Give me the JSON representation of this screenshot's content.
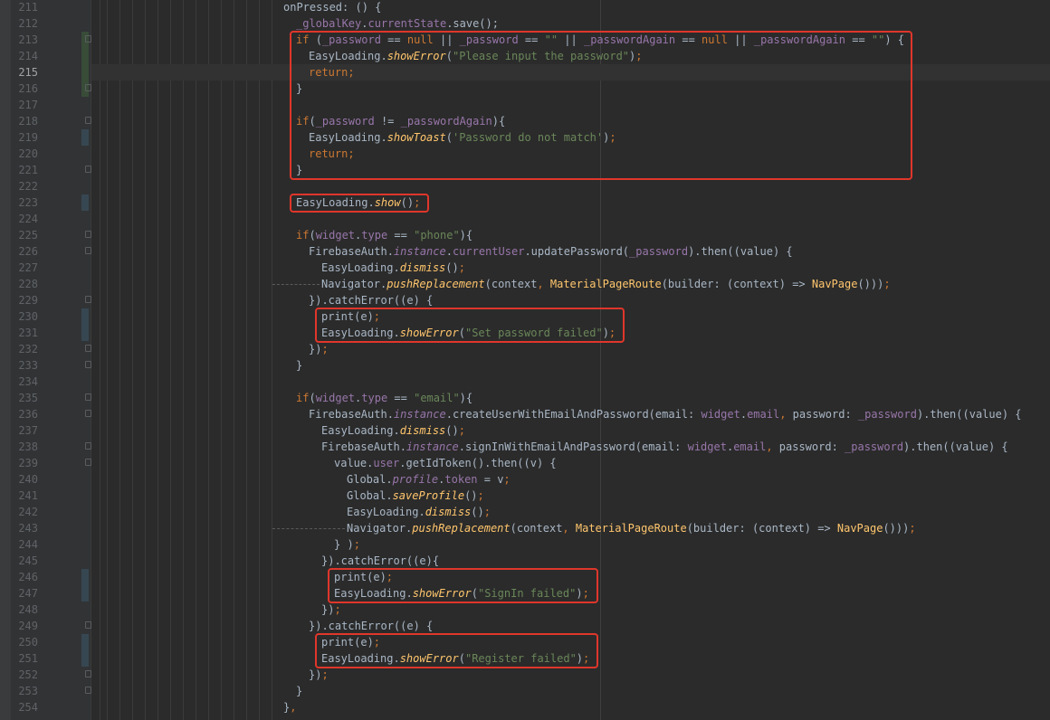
{
  "editor": {
    "current_line": 215,
    "lines": [
      {
        "n": 211,
        "indent": 0,
        "change": "",
        "fold": false,
        "t": [
          {
            "c": "",
            "v": "onPressed: () {"
          }
        ]
      },
      {
        "n": 212,
        "indent": 1,
        "change": "",
        "fold": false,
        "t": [
          {
            "c": "p",
            "v": "_globalKey"
          },
          {
            "c": "",
            "v": "."
          },
          {
            "c": "p",
            "v": "currentState"
          },
          {
            "c": "",
            "v": ".save();"
          }
        ]
      },
      {
        "n": 213,
        "indent": 1,
        "change": "add",
        "fold": true,
        "t": [
          {
            "c": "k",
            "v": "if "
          },
          {
            "c": "",
            "v": "("
          },
          {
            "c": "p",
            "v": "_password"
          },
          {
            "c": "",
            "v": " == "
          },
          {
            "c": "k",
            "v": "null"
          },
          {
            "c": "",
            "v": " || "
          },
          {
            "c": "p",
            "v": "_password"
          },
          {
            "c": "",
            "v": " == "
          },
          {
            "c": "s",
            "v": "\"\""
          },
          {
            "c": "",
            "v": " || "
          },
          {
            "c": "p",
            "v": "_passwordAgain"
          },
          {
            "c": "",
            "v": " == "
          },
          {
            "c": "k",
            "v": "null"
          },
          {
            "c": "",
            "v": " || "
          },
          {
            "c": "p",
            "v": "_passwordAgain"
          },
          {
            "c": "",
            "v": " == "
          },
          {
            "c": "s",
            "v": "\"\""
          },
          {
            "c": "",
            "v": ") {"
          }
        ]
      },
      {
        "n": 214,
        "indent": 2,
        "change": "add",
        "fold": false,
        "t": [
          {
            "c": "",
            "v": "EasyLoading."
          },
          {
            "c": "fi",
            "v": "showError"
          },
          {
            "c": "",
            "v": "("
          },
          {
            "c": "s",
            "v": "\"Please input the password\""
          },
          {
            "c": "",
            "v": ")"
          },
          {
            "c": "k",
            "v": ";"
          }
        ]
      },
      {
        "n": 215,
        "indent": 2,
        "change": "add",
        "fold": false,
        "t": [
          {
            "c": "k",
            "v": "return;"
          }
        ]
      },
      {
        "n": 216,
        "indent": 1,
        "change": "add",
        "fold": true,
        "t": [
          {
            "c": "",
            "v": "}"
          }
        ]
      },
      {
        "n": 217,
        "indent": 0,
        "change": "",
        "fold": false,
        "t": []
      },
      {
        "n": 218,
        "indent": 1,
        "change": "",
        "fold": true,
        "t": [
          {
            "c": "k",
            "v": "if"
          },
          {
            "c": "",
            "v": "("
          },
          {
            "c": "p",
            "v": "_password"
          },
          {
            "c": "",
            "v": " != "
          },
          {
            "c": "p",
            "v": "_passwordAgain"
          },
          {
            "c": "",
            "v": "){"
          }
        ]
      },
      {
        "n": 219,
        "indent": 2,
        "change": "mod",
        "fold": false,
        "t": [
          {
            "c": "",
            "v": "EasyLoading."
          },
          {
            "c": "fi",
            "v": "showToast"
          },
          {
            "c": "",
            "v": "("
          },
          {
            "c": "s",
            "v": "'Password do not match'"
          },
          {
            "c": "",
            "v": ")"
          },
          {
            "c": "k",
            "v": ";"
          }
        ]
      },
      {
        "n": 220,
        "indent": 2,
        "change": "",
        "fold": false,
        "t": [
          {
            "c": "k",
            "v": "return;"
          }
        ]
      },
      {
        "n": 221,
        "indent": 1,
        "change": "",
        "fold": true,
        "t": [
          {
            "c": "",
            "v": "}"
          }
        ]
      },
      {
        "n": 222,
        "indent": 0,
        "change": "",
        "fold": false,
        "t": []
      },
      {
        "n": 223,
        "indent": 1,
        "change": "mod",
        "fold": false,
        "t": [
          {
            "c": "",
            "v": "EasyLoading."
          },
          {
            "c": "fi",
            "v": "show"
          },
          {
            "c": "",
            "v": "()"
          },
          {
            "c": "k",
            "v": ";"
          }
        ]
      },
      {
        "n": 224,
        "indent": 0,
        "change": "",
        "fold": false,
        "t": []
      },
      {
        "n": 225,
        "indent": 1,
        "change": "",
        "fold": true,
        "t": [
          {
            "c": "k",
            "v": "if"
          },
          {
            "c": "",
            "v": "("
          },
          {
            "c": "p",
            "v": "widget"
          },
          {
            "c": "",
            "v": "."
          },
          {
            "c": "p",
            "v": "type"
          },
          {
            "c": "",
            "v": " == "
          },
          {
            "c": "s",
            "v": "\"phone\""
          },
          {
            "c": "",
            "v": "){"
          }
        ]
      },
      {
        "n": 226,
        "indent": 2,
        "change": "",
        "fold": true,
        "t": [
          {
            "c": "",
            "v": "FirebaseAuth."
          },
          {
            "c": "pi",
            "v": "instance"
          },
          {
            "c": "",
            "v": "."
          },
          {
            "c": "p",
            "v": "currentUser"
          },
          {
            "c": "",
            "v": ".updatePassword("
          },
          {
            "c": "p",
            "v": "_password"
          },
          {
            "c": "",
            "v": ").then((value) {"
          }
        ]
      },
      {
        "n": 227,
        "indent": 3,
        "change": "",
        "fold": false,
        "t": [
          {
            "c": "",
            "v": "EasyLoading."
          },
          {
            "c": "fi",
            "v": "dismiss"
          },
          {
            "c": "",
            "v": "()"
          },
          {
            "c": "k",
            "v": ";"
          }
        ]
      },
      {
        "n": 228,
        "indent": 3,
        "change": "",
        "fold": false,
        "dash": true,
        "t": [
          {
            "c": "",
            "v": "Navigator."
          },
          {
            "c": "fi",
            "v": "pushReplacement"
          },
          {
            "c": "",
            "v": "(context"
          },
          {
            "c": "k",
            "v": ", "
          },
          {
            "c": "f",
            "v": "MaterialPageRoute"
          },
          {
            "c": "",
            "v": "(builder: (context) => "
          },
          {
            "c": "f",
            "v": "NavPage"
          },
          {
            "c": "",
            "v": "()))"
          },
          {
            "c": "k",
            "v": ";"
          }
        ]
      },
      {
        "n": 229,
        "indent": 2,
        "change": "",
        "fold": true,
        "t": [
          {
            "c": "",
            "v": "}).catchError((e) {"
          }
        ]
      },
      {
        "n": 230,
        "indent": 3,
        "change": "mod",
        "fold": false,
        "t": [
          {
            "c": "",
            "v": "print(e)"
          },
          {
            "c": "k",
            "v": ";"
          }
        ]
      },
      {
        "n": 231,
        "indent": 3,
        "change": "mod",
        "fold": false,
        "t": [
          {
            "c": "",
            "v": "EasyLoading."
          },
          {
            "c": "fi",
            "v": "showError"
          },
          {
            "c": "",
            "v": "("
          },
          {
            "c": "s",
            "v": "\"Set password failed\""
          },
          {
            "c": "",
            "v": ")"
          },
          {
            "c": "k",
            "v": ";"
          }
        ]
      },
      {
        "n": 232,
        "indent": 2,
        "change": "",
        "fold": true,
        "t": [
          {
            "c": "",
            "v": "})"
          },
          {
            "c": "k",
            "v": ";"
          }
        ]
      },
      {
        "n": 233,
        "indent": 1,
        "change": "",
        "fold": true,
        "t": [
          {
            "c": "",
            "v": "}"
          }
        ]
      },
      {
        "n": 234,
        "indent": 0,
        "change": "",
        "fold": false,
        "t": []
      },
      {
        "n": 235,
        "indent": 1,
        "change": "",
        "fold": true,
        "t": [
          {
            "c": "k",
            "v": "if"
          },
          {
            "c": "",
            "v": "("
          },
          {
            "c": "p",
            "v": "widget"
          },
          {
            "c": "",
            "v": "."
          },
          {
            "c": "p",
            "v": "type"
          },
          {
            "c": "",
            "v": " == "
          },
          {
            "c": "s",
            "v": "\"email\""
          },
          {
            "c": "",
            "v": "){"
          }
        ]
      },
      {
        "n": 236,
        "indent": 2,
        "change": "",
        "fold": true,
        "t": [
          {
            "c": "",
            "v": "FirebaseAuth."
          },
          {
            "c": "pi",
            "v": "instance"
          },
          {
            "c": "",
            "v": ".createUserWithEmailAndPassword(email: "
          },
          {
            "c": "p",
            "v": "widget"
          },
          {
            "c": "",
            "v": "."
          },
          {
            "c": "p",
            "v": "email"
          },
          {
            "c": "k",
            "v": ", "
          },
          {
            "c": "",
            "v": "password: "
          },
          {
            "c": "p",
            "v": "_password"
          },
          {
            "c": "",
            "v": ").then((value) {"
          }
        ]
      },
      {
        "n": 237,
        "indent": 3,
        "change": "",
        "fold": false,
        "t": [
          {
            "c": "",
            "v": "EasyLoading."
          },
          {
            "c": "fi",
            "v": "dismiss"
          },
          {
            "c": "",
            "v": "()"
          },
          {
            "c": "k",
            "v": ";"
          }
        ]
      },
      {
        "n": 238,
        "indent": 3,
        "change": "",
        "fold": true,
        "t": [
          {
            "c": "",
            "v": "FirebaseAuth."
          },
          {
            "c": "pi",
            "v": "instance"
          },
          {
            "c": "",
            "v": ".signInWithEmailAndPassword(email: "
          },
          {
            "c": "p",
            "v": "widget"
          },
          {
            "c": "",
            "v": "."
          },
          {
            "c": "p",
            "v": "email"
          },
          {
            "c": "k",
            "v": ", "
          },
          {
            "c": "",
            "v": "password: "
          },
          {
            "c": "p",
            "v": "_password"
          },
          {
            "c": "",
            "v": ").then((value) {"
          }
        ]
      },
      {
        "n": 239,
        "indent": 4,
        "change": "",
        "fold": true,
        "t": [
          {
            "c": "",
            "v": "value."
          },
          {
            "c": "p",
            "v": "user"
          },
          {
            "c": "",
            "v": ".getIdToken().then((v) {"
          }
        ]
      },
      {
        "n": 240,
        "indent": 5,
        "change": "",
        "fold": false,
        "t": [
          {
            "c": "",
            "v": "Global."
          },
          {
            "c": "pi",
            "v": "profile"
          },
          {
            "c": "",
            "v": "."
          },
          {
            "c": "p",
            "v": "token"
          },
          {
            "c": "",
            "v": " = v"
          },
          {
            "c": "k",
            "v": ";"
          }
        ]
      },
      {
        "n": 241,
        "indent": 5,
        "change": "",
        "fold": false,
        "t": [
          {
            "c": "",
            "v": "Global."
          },
          {
            "c": "fi",
            "v": "saveProfile"
          },
          {
            "c": "",
            "v": "()"
          },
          {
            "c": "k",
            "v": ";"
          }
        ]
      },
      {
        "n": 242,
        "indent": 5,
        "change": "",
        "fold": false,
        "t": [
          {
            "c": "",
            "v": "EasyLoading."
          },
          {
            "c": "fi",
            "v": "dismiss"
          },
          {
            "c": "",
            "v": "()"
          },
          {
            "c": "k",
            "v": ";"
          }
        ]
      },
      {
        "n": 243,
        "indent": 5,
        "change": "",
        "fold": false,
        "dash": true,
        "t": [
          {
            "c": "",
            "v": "Navigator."
          },
          {
            "c": "fi",
            "v": "pushReplacement"
          },
          {
            "c": "",
            "v": "(context"
          },
          {
            "c": "k",
            "v": ", "
          },
          {
            "c": "f",
            "v": "MaterialPageRoute"
          },
          {
            "c": "",
            "v": "(builder: (context) => "
          },
          {
            "c": "f",
            "v": "NavPage"
          },
          {
            "c": "",
            "v": "()))"
          },
          {
            "c": "k",
            "v": ";"
          }
        ]
      },
      {
        "n": 244,
        "indent": 4,
        "change": "",
        "fold": false,
        "t": [
          {
            "c": "",
            "v": "} )"
          },
          {
            "c": "k",
            "v": ";"
          }
        ]
      },
      {
        "n": 245,
        "indent": 3,
        "change": "",
        "fold": false,
        "t": [
          {
            "c": "",
            "v": "}).catchError((e){"
          }
        ]
      },
      {
        "n": 246,
        "indent": 4,
        "change": "mod",
        "fold": false,
        "t": [
          {
            "c": "",
            "v": "print(e)"
          },
          {
            "c": "k",
            "v": ";"
          }
        ]
      },
      {
        "n": 247,
        "indent": 4,
        "change": "mod",
        "fold": false,
        "t": [
          {
            "c": "",
            "v": "EasyLoading."
          },
          {
            "c": "fi",
            "v": "showError"
          },
          {
            "c": "",
            "v": "("
          },
          {
            "c": "s",
            "v": "\"SignIn failed\""
          },
          {
            "c": "",
            "v": ")"
          },
          {
            "c": "k",
            "v": ";"
          }
        ]
      },
      {
        "n": 248,
        "indent": 3,
        "change": "",
        "fold": false,
        "t": [
          {
            "c": "",
            "v": "})"
          },
          {
            "c": "k",
            "v": ";"
          }
        ]
      },
      {
        "n": 249,
        "indent": 2,
        "change": "",
        "fold": true,
        "t": [
          {
            "c": "",
            "v": "}).catchError((e) {"
          }
        ]
      },
      {
        "n": 250,
        "indent": 3,
        "change": "mod",
        "fold": false,
        "t": [
          {
            "c": "",
            "v": "print(e)"
          },
          {
            "c": "k",
            "v": ";"
          }
        ]
      },
      {
        "n": 251,
        "indent": 3,
        "change": "mod",
        "fold": false,
        "t": [
          {
            "c": "",
            "v": "EasyLoading."
          },
          {
            "c": "fi",
            "v": "showError"
          },
          {
            "c": "",
            "v": "("
          },
          {
            "c": "s",
            "v": "\"Register failed\""
          },
          {
            "c": "",
            "v": ")"
          },
          {
            "c": "k",
            "v": ";"
          }
        ]
      },
      {
        "n": 252,
        "indent": 2,
        "change": "",
        "fold": true,
        "t": [
          {
            "c": "",
            "v": "})"
          },
          {
            "c": "k",
            "v": ";"
          }
        ]
      },
      {
        "n": 253,
        "indent": 1,
        "change": "",
        "fold": true,
        "t": [
          {
            "c": "",
            "v": "}"
          }
        ]
      },
      {
        "n": 254,
        "indent": 0,
        "change": "",
        "fold": false,
        "t": [
          {
            "c": "",
            "v": "}"
          },
          {
            "c": "k",
            "v": ","
          }
        ]
      }
    ],
    "highlight_boxes": [
      {
        "label": "empty-password-check",
        "from": 213,
        "to": 221
      },
      {
        "label": "show-loading",
        "from": 223,
        "to": 223
      },
      {
        "label": "set-password-error",
        "from": 230,
        "to": 231
      },
      {
        "label": "signin-error",
        "from": 246,
        "to": 247
      },
      {
        "label": "register-error",
        "from": 250,
        "to": 251
      }
    ],
    "colors": {
      "background": "#2b2b2b",
      "gutter": "#313335",
      "line_number": "#606366",
      "keyword": "#cc7832",
      "string": "#6a8759",
      "field": "#9876aa",
      "function": "#ffc66d",
      "default": "#a9b7c6",
      "highlight_box": "#e0362b"
    }
  }
}
